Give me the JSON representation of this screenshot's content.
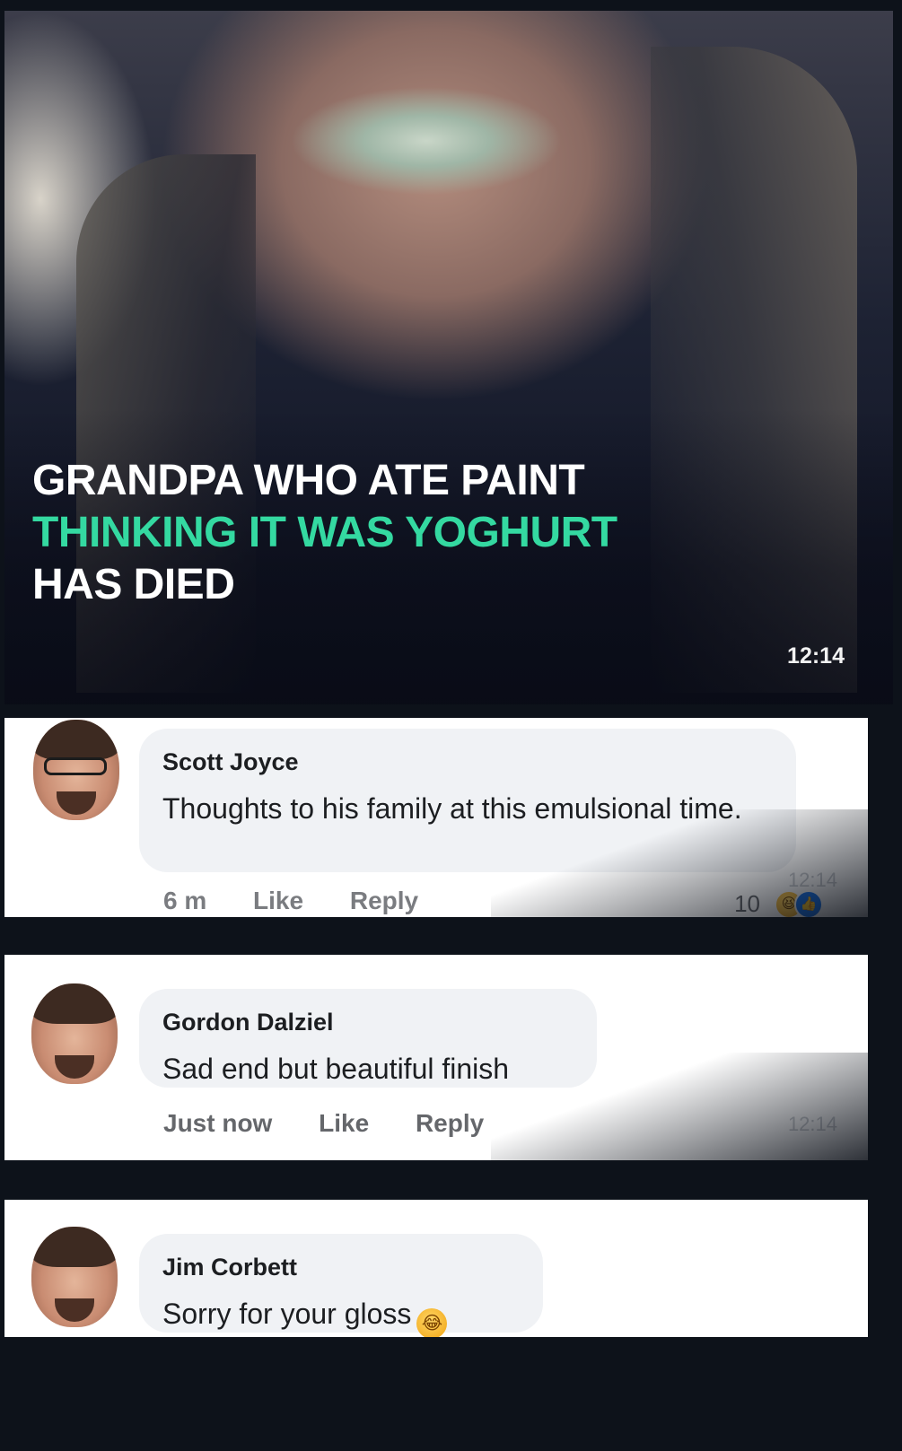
{
  "video": {
    "headline_line1": "GRANDPA WHO ATE PAINT",
    "headline_line2": "THINKING IT WAS YOGHURT",
    "headline_line3": "HAS DIED",
    "duration": "12:14",
    "accent_color": "#34d9a1"
  },
  "comments": [
    {
      "author": "Scott Joyce",
      "text": "Thoughts to his family at this emulsional time.",
      "time": "6 m",
      "like_label": "Like",
      "reply_label": "Reply",
      "reaction_count": "10",
      "reaction_icons": [
        "haha-icon",
        "like-icon"
      ],
      "overlay_time": "12:14"
    },
    {
      "author": "Gordon Dalziel",
      "text": "Sad end but beautiful finish",
      "time": "Just now",
      "like_label": "Like",
      "reply_label": "Reply",
      "overlay_time": "12:14"
    },
    {
      "author": "Jim Corbett",
      "text": "Sorry for your gloss",
      "emoji": "😂"
    }
  ]
}
